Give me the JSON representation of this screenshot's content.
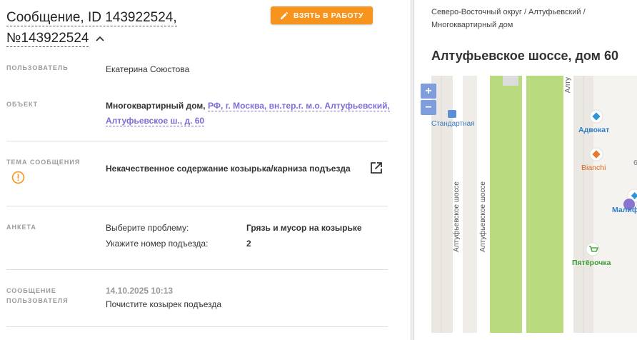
{
  "message": {
    "title_line1": "Сообщение, ID 143922524,",
    "title_line2": "№143922524",
    "take_button": "ВЗЯТЬ В РАБОТУ"
  },
  "fields": {
    "user_label": "ПОЛЬЗОВАТЕЛЬ",
    "user_value": "Екатерина Союстова",
    "object_label": "ОБЪЕКТ",
    "object_type": "Многоквартирный дом,",
    "object_address": "РФ, г. Москва, вн.тер.г. м.о. Алтуфьевский, Алтуфьевское ш., д. 60",
    "topic_label": "ТЕМА СООБЩЕНИЯ",
    "topic_value": "Некачественное содержание козырька/карниза подъезда",
    "survey_label": "АНКЕТА",
    "survey_items": [
      {
        "question": "Выберите проблему:",
        "answer": "Грязь и мусор на козырьке"
      },
      {
        "question": "Укажите номер подъезда:",
        "answer": "2"
      }
    ],
    "user_msg_label1": "СООБЩЕНИЕ",
    "user_msg_label2": "ПОЛЬЗОВАТЕЛЯ",
    "user_msg_date": "14.10.2025 10:13",
    "user_msg_text": "Почистите козырек подъезда"
  },
  "right": {
    "breadcrumb_line1": "Северо-Восточный округ / Алтуфьевский /",
    "breadcrumb_line2": "Многоквартирный дом",
    "address_title": "Алтуфьевское шоссе, дом 60"
  },
  "map": {
    "zoom_in": "+",
    "zoom_out": "−",
    "label_standard": "Стандартная",
    "label_road1": "Алтуфьевское шоссе",
    "label_road2": "Алтуфьевское шоссе",
    "label_top_road": "Алту",
    "poi_advokat": "Адвокат",
    "poi_bianchi": "Bianchi",
    "poi_malif": "Малиф",
    "poi_pyaterochka": "Пятёрочка",
    "label_edge": "6"
  },
  "colors": {
    "accent_orange": "#f7941d",
    "link_purple": "#7b6fd6",
    "map_green": "#b9da7f",
    "map_zoom_blue": "#7d9ddd",
    "poi_blue": "#2f95d6",
    "poi_orange": "#e8782a",
    "poi_green": "#4ab043",
    "marker_purple": "#8a74cf"
  }
}
